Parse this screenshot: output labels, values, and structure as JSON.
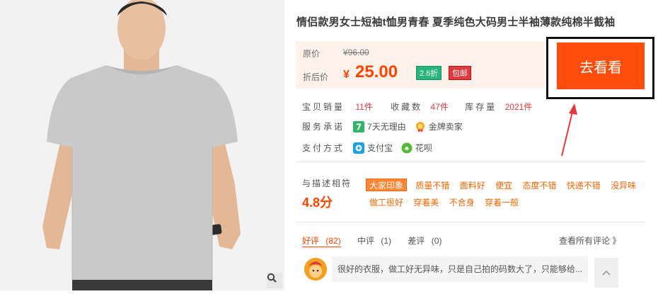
{
  "product": {
    "title": "情侣款男女士短袖t恤男青春 夏季纯色大码男士半袖薄款纯棉半截袖",
    "image_alt": "灰色短袖T恤男模特"
  },
  "price": {
    "original_label": "原价",
    "original_value": "¥96.00",
    "current_label": "折后价",
    "currency": "¥",
    "current_value": "25.00",
    "discount_badge": "2.6折",
    "shipping_badge": "包邮"
  },
  "goto_button": "去看看",
  "stats": {
    "sales_label": "宝贝销量",
    "sales_value": "11件",
    "fav_label": "收藏数",
    "fav_value": "47件",
    "stock_label": "库存量",
    "stock_value": "2021件"
  },
  "service": {
    "label": "服务承诺",
    "items": [
      "7天无理由",
      "金牌卖家"
    ]
  },
  "payment": {
    "label": "支付方式",
    "items": [
      "支付宝",
      "花呗"
    ]
  },
  "rating": {
    "label": "与描述相符",
    "score": "4.8分",
    "tags": [
      "大家印象",
      "质量不错",
      "面料好",
      "便宜",
      "态度不错",
      "快递不错",
      "没异味",
      "做工很好",
      "穿着美",
      "不合身",
      "穿着一般"
    ]
  },
  "reviews": {
    "tabs": [
      {
        "label": "好评",
        "count": "(82)"
      },
      {
        "label": "中评",
        "count": "(1)"
      },
      {
        "label": "差评",
        "count": "(0)"
      }
    ],
    "see_all": "查看所有评论 》",
    "first_comment": "很好的衣服，做工好无异味，只是自己拍的码数大了，只能够给..."
  },
  "colors": {
    "accent": "#ff4e0c",
    "price": "#ff4400",
    "price_box_bg": "#fff2ea",
    "discount_badge": "#27b57a",
    "shipping_badge": "#e4393c",
    "shirt": "#c9c9c9"
  },
  "icons": {
    "zoom": "magnifier-icon",
    "arrow": "red-arrow-annotation",
    "scroll": "chevron-up-icon"
  }
}
